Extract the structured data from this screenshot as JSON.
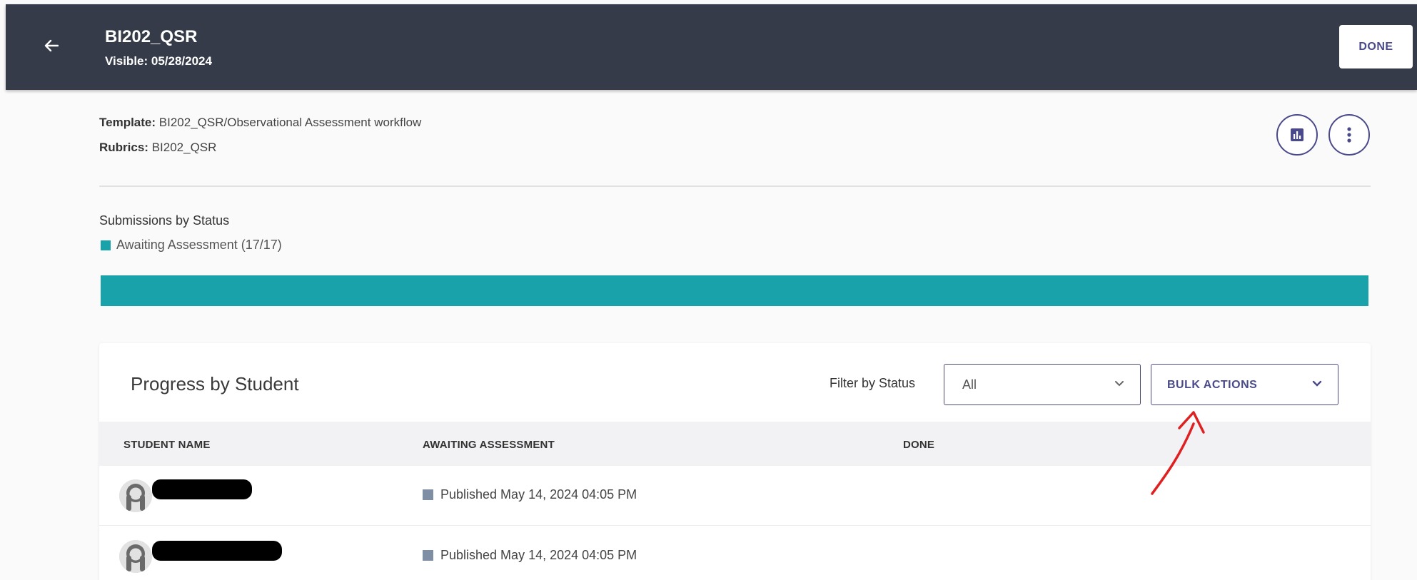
{
  "header": {
    "title": "BI202_QSR",
    "subtitle": "Visible: 05/28/2024",
    "done_label": "DONE"
  },
  "meta": {
    "template_label": "Template:",
    "template_value": "BI202_QSR/Observational Assessment workflow",
    "rubrics_label": "Rubrics:",
    "rubrics_value": "BI202_QSR"
  },
  "status_section": {
    "heading": "Submissions by Status",
    "legend": [
      {
        "label": "Awaiting Assessment (17/17)",
        "color": "#1aa2ab"
      }
    ],
    "progress_fraction": 1.0
  },
  "progress_card": {
    "title": "Progress by Student",
    "filter_label": "Filter by Status",
    "filter_value": "All",
    "bulk_actions_label": "BULK ACTIONS",
    "columns": [
      "STUDENT NAME",
      "AWAITING ASSESSMENT",
      "DONE"
    ],
    "rows": [
      {
        "status_text": "Published May 14, 2024 04:05 PM"
      },
      {
        "status_text": "Published May 14, 2024 04:05 PM"
      }
    ]
  },
  "colors": {
    "header_bg": "#353b48",
    "accent": "#4a4a8a",
    "awaiting": "#1aa2ab",
    "published": "#7d8ea5",
    "annotation": "#e02020"
  },
  "icons": {
    "back": "arrow-left-icon",
    "stats": "bar-chart-icon",
    "more": "more-vertical-icon",
    "chevron": "chevron-down-icon",
    "avatar": "user-avatar-icon"
  }
}
